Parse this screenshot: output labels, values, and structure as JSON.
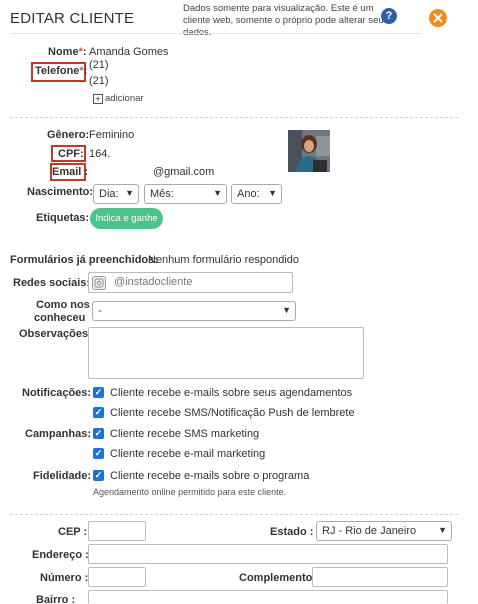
{
  "header": {
    "title": "EDITAR CLIENTE",
    "notice": "Dados somente para visualização. Este é um cliente web, somente o próprio pode alterar seus dados.",
    "help_icon": "question-circle-icon",
    "close_icon": "close-circle-icon",
    "accent_blue": "#2d5fa8",
    "accent_orange": "#f08a1a"
  },
  "contact": {
    "name_label": "Nome",
    "name_value": "Amanda Gomes",
    "phone_label": "Telefone",
    "phone_1": "(21)",
    "phone_2": "(21)",
    "add_label": "adicionar",
    "required_mark": "*",
    "colon": ":"
  },
  "profile": {
    "gender_label": "Gênero:",
    "gender_value": "Feminino",
    "cpf_label": "CPF:",
    "cpf_value": "164.",
    "email_label": "Email :",
    "email_value": "@gmail.com",
    "birth_label": "Nascimento:",
    "day_value": "Dia:",
    "month_value": "Mês:",
    "year_value": "Ano:",
    "tags_label": "Etiquetas:",
    "tag_badge": "Indica e ganhe",
    "tag_color": "#4cc38a"
  },
  "forms": {
    "label": "Formulários já preenchidos:",
    "value": "Nenhum formulário respondido"
  },
  "social": {
    "label": "Redes sociais:",
    "placeholder": "@instadocliente"
  },
  "source": {
    "label_line1": "Como nos",
    "label_line2": "conheceu",
    "value": "-"
  },
  "notes": {
    "label": "Observações:"
  },
  "notifications": {
    "label": "Notificações:",
    "items": [
      "Cliente recebe e-mails sobre seus agendamentos",
      "Cliente recebe SMS/Notificação Push de lembrete"
    ]
  },
  "campaigns": {
    "label": "Campanhas:",
    "items": [
      "Cliente recebe SMS marketing",
      "Cliente recebe e-mail marketing"
    ]
  },
  "loyalty": {
    "label": "Fidelidade:",
    "items": [
      "Cliente recebe e-mails sobre o programa"
    ],
    "note": "Agendamento online permitido para este cliente."
  },
  "address": {
    "cep_label": "CEP :",
    "state_label": "Estado :",
    "state_value": "RJ - Rio de Janeiro",
    "street_label": "Endereço :",
    "number_label": "Número :",
    "complement_label": "Complemento:",
    "district_label": "Bairro :"
  }
}
